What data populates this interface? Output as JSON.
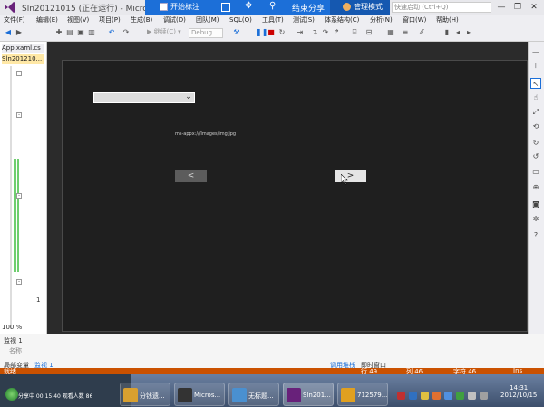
{
  "window": {
    "title": "Sln20121015 (正在运行) - Microso",
    "quick_launch": "快速启动 (Ctrl+Q)",
    "minimize": "—",
    "restore": "❐",
    "close": "✕"
  },
  "share_bar": {
    "start_annotate": "开始标注",
    "stop_share": "结束分享",
    "admin_mode": "管理模式"
  },
  "menu": {
    "items": [
      "文件(F)",
      "编辑(E)",
      "视图(V)",
      "项目(P)",
      "生成(B)",
      "调试(D)",
      "团队(M)",
      "SQL(Q)",
      "工具(T)",
      "测试(S)",
      "体系结构(C)",
      "分析(N)",
      "窗口(W)",
      "帮助(H)"
    ]
  },
  "toolbar": {
    "continue_label": "▶ 继续(C) ▾",
    "config_value": "Debug"
  },
  "editor": {
    "tab_file": "App.xaml.cs",
    "tab_solution": "Sln201210...",
    "zoom": "100 %",
    "line_number": "1"
  },
  "panels": {
    "watch_title": "监视 1",
    "name_col": "名称",
    "locals_tab": "局部变量",
    "watch_tab": "监视 1",
    "callstack_tab": "调用堆栈",
    "immediate_tab": "即时窗口"
  },
  "app": {
    "image_path": "ms-appx:///Images/img.jpg",
    "prev_label": "<",
    "next_label": ">"
  },
  "status": {
    "ready": "就绪",
    "line": "行 49",
    "col": "列 46",
    "char": "字符 46",
    "mode": "Ins"
  },
  "taskbar": {
    "sharing_text": "分享中 00:15:40 观看人数 86",
    "buttons": [
      "分钱遗...",
      "Micros...",
      "无标题...",
      "Sln201...",
      "712579..."
    ],
    "time": "14:31",
    "date": "2012/10/15"
  },
  "colors": {
    "status_orange": "#ca5100",
    "share_blue": "#1c6fd8",
    "vs_purple": "#68217a"
  }
}
